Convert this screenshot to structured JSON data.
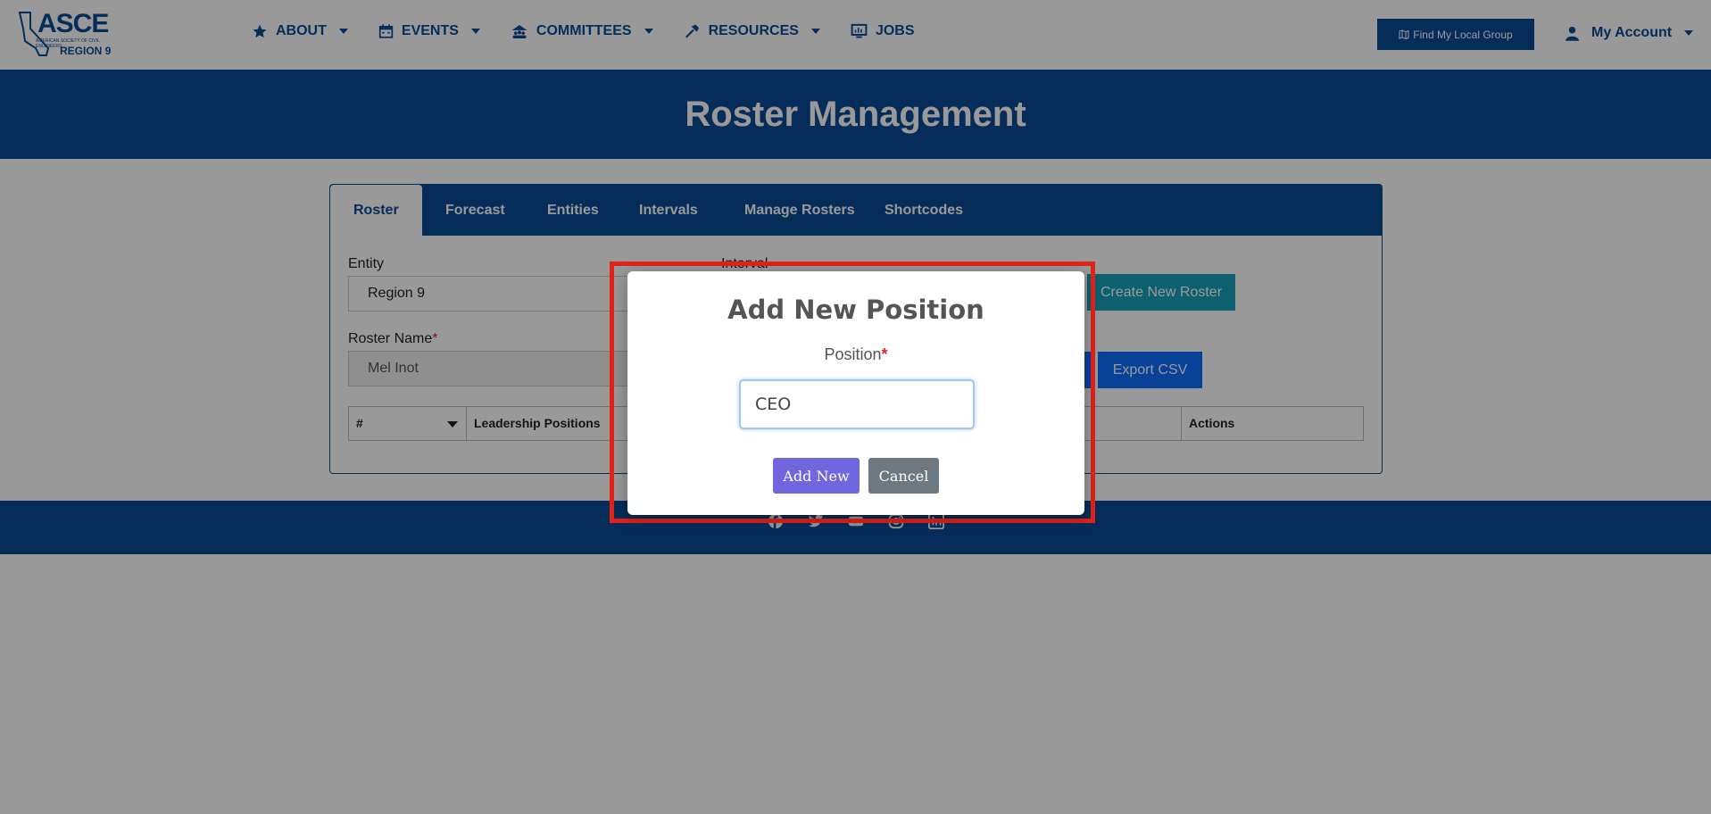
{
  "header": {
    "logo": {
      "brand": "ASCE",
      "tagline": "AMERICAN SOCIETY OF CIVIL ENGINEERS",
      "region": "REGION 9"
    },
    "nav": [
      {
        "label": "ABOUT",
        "icon": "star-icon"
      },
      {
        "label": "EVENTS",
        "icon": "calendar-icon"
      },
      {
        "label": "COMMITTEES",
        "icon": "people-icon"
      },
      {
        "label": "RESOURCES",
        "icon": "hammer-icon"
      },
      {
        "label": "JOBS",
        "icon": "presentation-icon"
      }
    ],
    "find_group": "Find My Local Group",
    "account": "My Account"
  },
  "banner": {
    "title": "Roster Management"
  },
  "tabs": [
    "Roster",
    "Forecast",
    "Entities",
    "Intervals",
    "Manage Rosters",
    "Shortcodes"
  ],
  "form": {
    "entity_label": "Entity",
    "entity_value": "Region 9",
    "interval_label": "Interval",
    "roster_name_label": "Roster Name",
    "roster_name_required": "*",
    "roster_name_value": "Mel Inot",
    "create_roster": "Create New Roster",
    "export_csv": "Export CSV"
  },
  "table": {
    "columns": [
      "#",
      "Leadership Positions",
      "Actions"
    ]
  },
  "footer": {
    "social": [
      "facebook-icon",
      "twitter-icon",
      "youtube-icon",
      "instagram-icon",
      "linkedin-icon"
    ]
  },
  "modal": {
    "title": "Add New Position",
    "position_label": "Position",
    "required_mark": "*",
    "position_value": "CEO",
    "add_label": "Add New",
    "cancel_label": "Cancel"
  },
  "colors": {
    "primary": "#0a4c97",
    "highlight": "#e2231a",
    "add_button": "#7066e0",
    "cancel_button": "#6e7881",
    "teal": "#17a2b8"
  }
}
